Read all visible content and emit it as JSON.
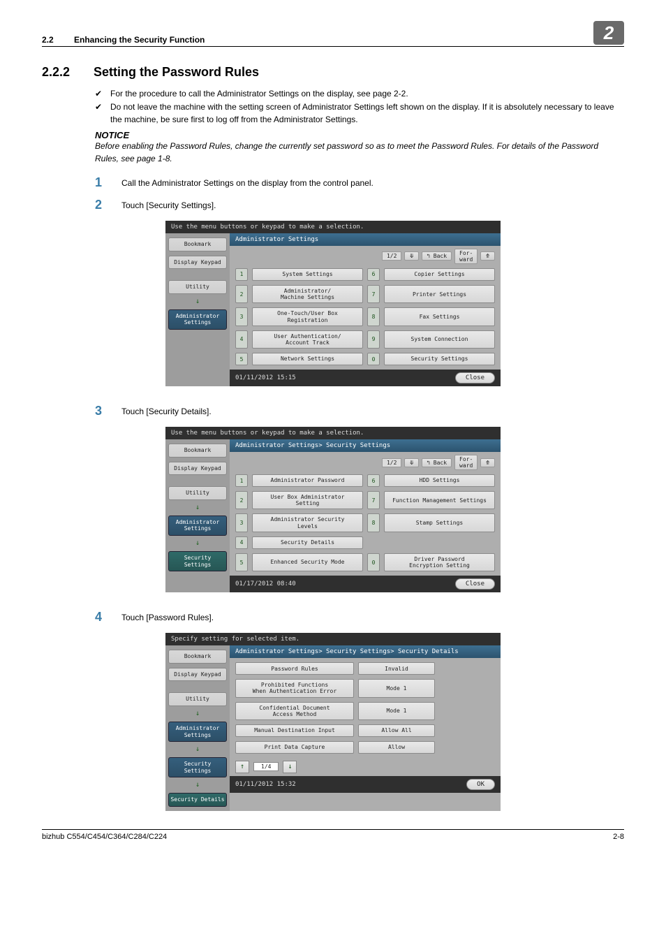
{
  "header": {
    "section_no": "2.2",
    "section_title": "Enhancing the Security Function",
    "badge": "2"
  },
  "section": {
    "num": "2.2.2",
    "title": "Setting the Password Rules"
  },
  "checks": [
    "For the procedure to call the Administrator Settings on the display, see page 2-2.",
    "Do not leave the machine with the setting screen of Administrator Settings left shown on the display. If it is absolutely necessary to leave the machine, be sure first to log off from the Administrator Settings."
  ],
  "notice": {
    "heading": "NOTICE",
    "body": "Before enabling the Password Rules, change the currently set password so as to meet the Password Rules. For details of the Password Rules, see page 1-8."
  },
  "steps": [
    "Call the Administrator Settings on the display from the control panel.",
    "Touch [Security Settings].",
    "Touch [Security Details].",
    "Touch [Password Rules]."
  ],
  "panel_common": {
    "side": {
      "bookmark": "Bookmark",
      "display_keypad": "Display Keypad",
      "utility": "Utility",
      "admin": "Administrator Settings",
      "security": "Security Settings",
      "security_details": "Security Details"
    },
    "pager": {
      "back": "↰ Back",
      "forward": "For-\nward"
    },
    "close": "Close",
    "ok": "OK"
  },
  "panel1": {
    "top": "Use the menu buttons or keypad to make a selection.",
    "crumb": "Administrator Settings",
    "page": "1/2",
    "items_left": [
      "System Settings",
      "Administrator/\nMachine Settings",
      "One-Touch/User Box\nRegistration",
      "User Authentication/\nAccount Track",
      "Network Settings"
    ],
    "items_right": [
      "Copier Settings",
      "Printer Settings",
      "Fax Settings",
      "System Connection",
      "Security Settings"
    ],
    "nums_left": [
      "1",
      "2",
      "3",
      "4",
      "5"
    ],
    "nums_right": [
      "6",
      "7",
      "8",
      "9",
      "0"
    ],
    "datetime": "01/11/2012   15:15"
  },
  "panel2": {
    "top": "Use the menu buttons or keypad to make a selection.",
    "crumb": "Administrator Settings> Security Settings",
    "page": "1/2",
    "items_left": [
      "Administrator Password",
      "User Box Administrator\nSetting",
      "Administrator Security\nLevels",
      "Security Details",
      "Enhanced Security Mode"
    ],
    "items_right": [
      "HDD Settings",
      "Function Management Settings",
      "Stamp Settings",
      "",
      "Driver Password\nEncryption Setting"
    ],
    "nums_left": [
      "1",
      "2",
      "3",
      "4",
      "5"
    ],
    "nums_right": [
      "6",
      "7",
      "8",
      "",
      "0"
    ],
    "datetime": "01/17/2012   08:40"
  },
  "panel3": {
    "top": "Specify setting for selected item.",
    "crumb": "Administrator Settings> Security Settings> Security Details",
    "rows": [
      {
        "label": "Password Rules",
        "value": "Invalid"
      },
      {
        "label": "Prohibited Functions\nWhen Authentication Error",
        "value": "Mode 1"
      },
      {
        "label": "Confidential Document\nAccess Method",
        "value": "Mode 1"
      },
      {
        "label": "Manual Destination Input",
        "value": "Allow All"
      },
      {
        "label": "Print Data Capture",
        "value": "Allow"
      }
    ],
    "page": "1/4",
    "datetime": "01/11/2012   15:32"
  },
  "footer": {
    "left": "bizhub C554/C454/C364/C284/C224",
    "right": "2-8"
  }
}
